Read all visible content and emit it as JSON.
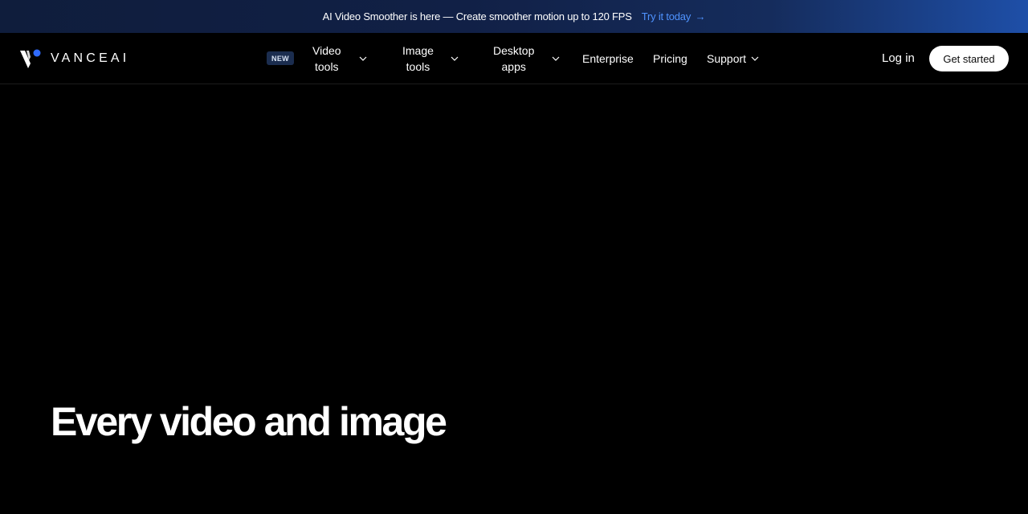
{
  "announcement": {
    "message": "AI Video Smoother is here — Create smoother motion up to 120 FPS",
    "cta_label": "Try it today",
    "cta_arrow": "→",
    "cta_color": "#4f93ff"
  },
  "brand": {
    "name": "VANCEAI",
    "accent": "#2f6bff"
  },
  "nav": {
    "new_badge": "NEW",
    "items": [
      {
        "line1": "Video",
        "line2": "tools",
        "icon": "chevron-down-icon"
      },
      {
        "line1": "Image",
        "line2": "tools",
        "icon": "chevron-down-icon"
      },
      {
        "line1": "Desktop",
        "line2": "apps",
        "icon": "chevron-down-icon"
      },
      {
        "label": "Enterprise"
      },
      {
        "label": "Pricing"
      },
      {
        "label": "Support",
        "icon": "chevron-down-icon"
      }
    ],
    "login_label": "Log in",
    "cta_label": "Get started"
  },
  "hero": {
    "title": "Every video and image"
  }
}
